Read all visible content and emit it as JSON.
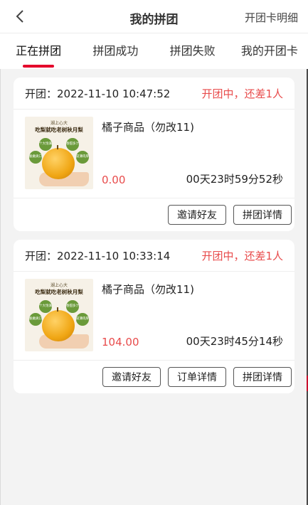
{
  "header": {
    "title": "我的拼团",
    "right_link": "开团卡明细"
  },
  "tabs": [
    {
      "label": "正在拼团",
      "active": true
    },
    {
      "label": "拼团成功",
      "active": false
    },
    {
      "label": "拼团失败",
      "active": false
    },
    {
      "label": "我的开团卡",
      "active": false
    }
  ],
  "colors": {
    "accent": "#e4002b",
    "status": "#e84b4b"
  },
  "thumbnail": {
    "brand": "湖上心大",
    "headline": "吃梨就吃老树秋月梨",
    "bubbles": [
      "个大饱满",
      "香甜多汁",
      "脆嫩爽口",
      "皮薄肉厚"
    ]
  },
  "orders": [
    {
      "open_time": "开团：2022-11-10 10:47:52",
      "status": "开团中，还差1人",
      "product_name": "橘子商品（勿改11)",
      "price": "0.00",
      "countdown": "00天23时59分52秒",
      "actions": [
        "邀请好友",
        "拼团详情"
      ]
    },
    {
      "open_time": "开团：2022-11-10 10:33:14",
      "status": "开团中，还差1人",
      "product_name": "橘子商品（勿改11)",
      "price": "104.00",
      "countdown": "00天23时45分14秒",
      "actions": [
        "邀请好友",
        "订单详情",
        "拼团详情"
      ]
    }
  ]
}
